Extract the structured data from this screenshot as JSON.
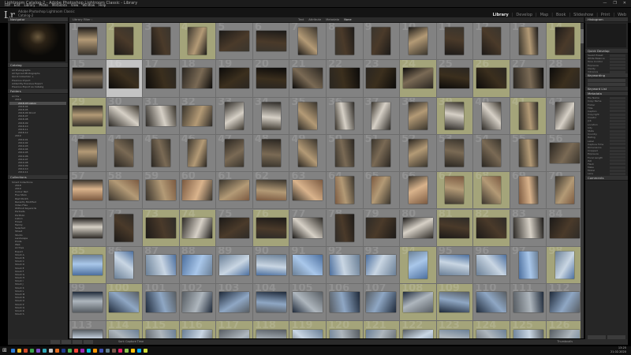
{
  "window": {
    "title": "Lightroom Catalog-2 - Adobe Photoshop Lightroom Classic - Library",
    "controls": [
      "—",
      "❐",
      "✕"
    ]
  },
  "menu": [
    "File",
    "Edit",
    "Library",
    "Photo",
    "Metadata",
    "View",
    "Window",
    "Help"
  ],
  "identity": {
    "logo": "Lr",
    "line1": "Adobe Photoshop Lightroom Classic",
    "line2": "Catalog-2"
  },
  "modules": [
    "Library",
    "Develop",
    "Map",
    "Book",
    "Slideshow",
    "Print",
    "Web"
  ],
  "active_module": "Library",
  "left_panel": {
    "navigator": "Navigator",
    "catalog": {
      "title": "Catalog",
      "items": [
        "All Photographs",
        "All Synced Photographs",
        "Quick Collection +",
        "Previous Import",
        "Added By Previous Export",
        "Previous Export as Catalog"
      ]
    },
    "folders": {
      "title": "Folders",
      "items": [
        "Archiv",
        "2018",
        "2018-03 Lisbon",
        "2018-04",
        "2018-05",
        "2018-06 Shoot",
        "2018-07",
        "2018-08",
        "2018-09",
        "2018-10",
        "2018-11",
        "2018-12",
        "2019",
        "2019-01",
        "2019-02",
        "2019-03",
        "2019-04",
        "2019-05",
        "2019-06",
        "2019-07",
        "2019-08",
        "2019-09",
        "2019-10",
        "2019-11"
      ]
    },
    "collections": {
      "title": "Collections",
      "items": [
        "Smart Collections",
        "2018",
        "2019",
        "Colour Red",
        "Five Stars",
        "Past Month",
        "Recently Modified",
        "Video Files",
        "Without Keywords",
        "Portraits",
        "Portfolio",
        "Lisbon",
        "Travel",
        "Family",
        "Selected",
        "Street",
        "Studio",
        "Landscape",
        "Prints",
        "Web",
        "Archive",
        "Export",
        "Shoot A",
        "Shoot B",
        "Shoot C",
        "Shoot D",
        "Shoot E",
        "Shoot F",
        "Shoot G",
        "Shoot H",
        "Shoot I",
        "Shoot J",
        "Shoot K",
        "Shoot L",
        "Shoot M",
        "Shoot N",
        "Shoot O",
        "Shoot P",
        "Shoot Q",
        "Shoot R",
        "Shoot S"
      ]
    }
  },
  "right_panel": {
    "histogram": "Histogram",
    "quick_develop": "Quick Develop",
    "keywording": "Keywording",
    "keyword_list": "Keyword List",
    "metadata": "Metadata",
    "comments": "Comments",
    "fields": [
      "Saved Preset",
      "White Balance",
      "Tone Control",
      "Exposure",
      "Clarity",
      "Vibrance",
      "File Name",
      "Copy Name",
      "Folder",
      "Title",
      "Caption",
      "Copyright",
      "Creator",
      "Job",
      "Location",
      "City",
      "State",
      "Country",
      "Rating",
      "Label",
      "Capture Time",
      "Dimensions",
      "Cropped",
      "Exposure",
      "Focal Length",
      "ISO",
      "Flash",
      "Make",
      "Model",
      "Lens"
    ],
    "buttons": [
      "Sync Metadata",
      "Sync Settings"
    ]
  },
  "grid_toolbar": {
    "label": "Library Filter :",
    "filters": [
      "Text",
      "Attribute",
      "Metadata",
      "None"
    ],
    "active_filter": "None"
  },
  "bottom_bar": {
    "sort": "Sort: Capture Time",
    "thumbs": "Thumbnails"
  },
  "taskbar": {
    "time": "13:25",
    "date": "21.02.2020"
  },
  "grid": {
    "columns": 14,
    "start_number": 1,
    "rows": [
      {
        "pick": [
          1,
          3,
          13
        ],
        "thumbs": "ppppllppppppppl"
      },
      {
        "pick": [
          9,
          11
        ],
        "sel": [
          1
        ],
        "thumbs": "lllllllllllllll"
      },
      {
        "pick": [
          0,
          10,
          12
        ],
        "thumbs": "llllpppppppppp"
      },
      {
        "pick": [],
        "thumbs": "pppppppppppppl"
      },
      {
        "pick": [
          10,
          11
        ],
        "thumbs": "lllllllpppppppp"
      },
      {
        "pick": [
          2,
          3,
          5,
          10,
          11
        ],
        "thumbs": "lplllllpllllll"
      },
      {
        "pick": [
          0,
          9,
          13
        ],
        "thumbs": "lplllllllpllpp"
      },
      {
        "pick": [
          1,
          9,
          10
        ],
        "thumbs": "lllllllllllll"
      },
      {
        "pick": [
          1,
          2,
          3,
          4,
          5,
          6,
          7,
          8,
          9,
          10,
          11,
          12,
          13
        ],
        "thumbs": "lllllllllllll"
      }
    ]
  }
}
